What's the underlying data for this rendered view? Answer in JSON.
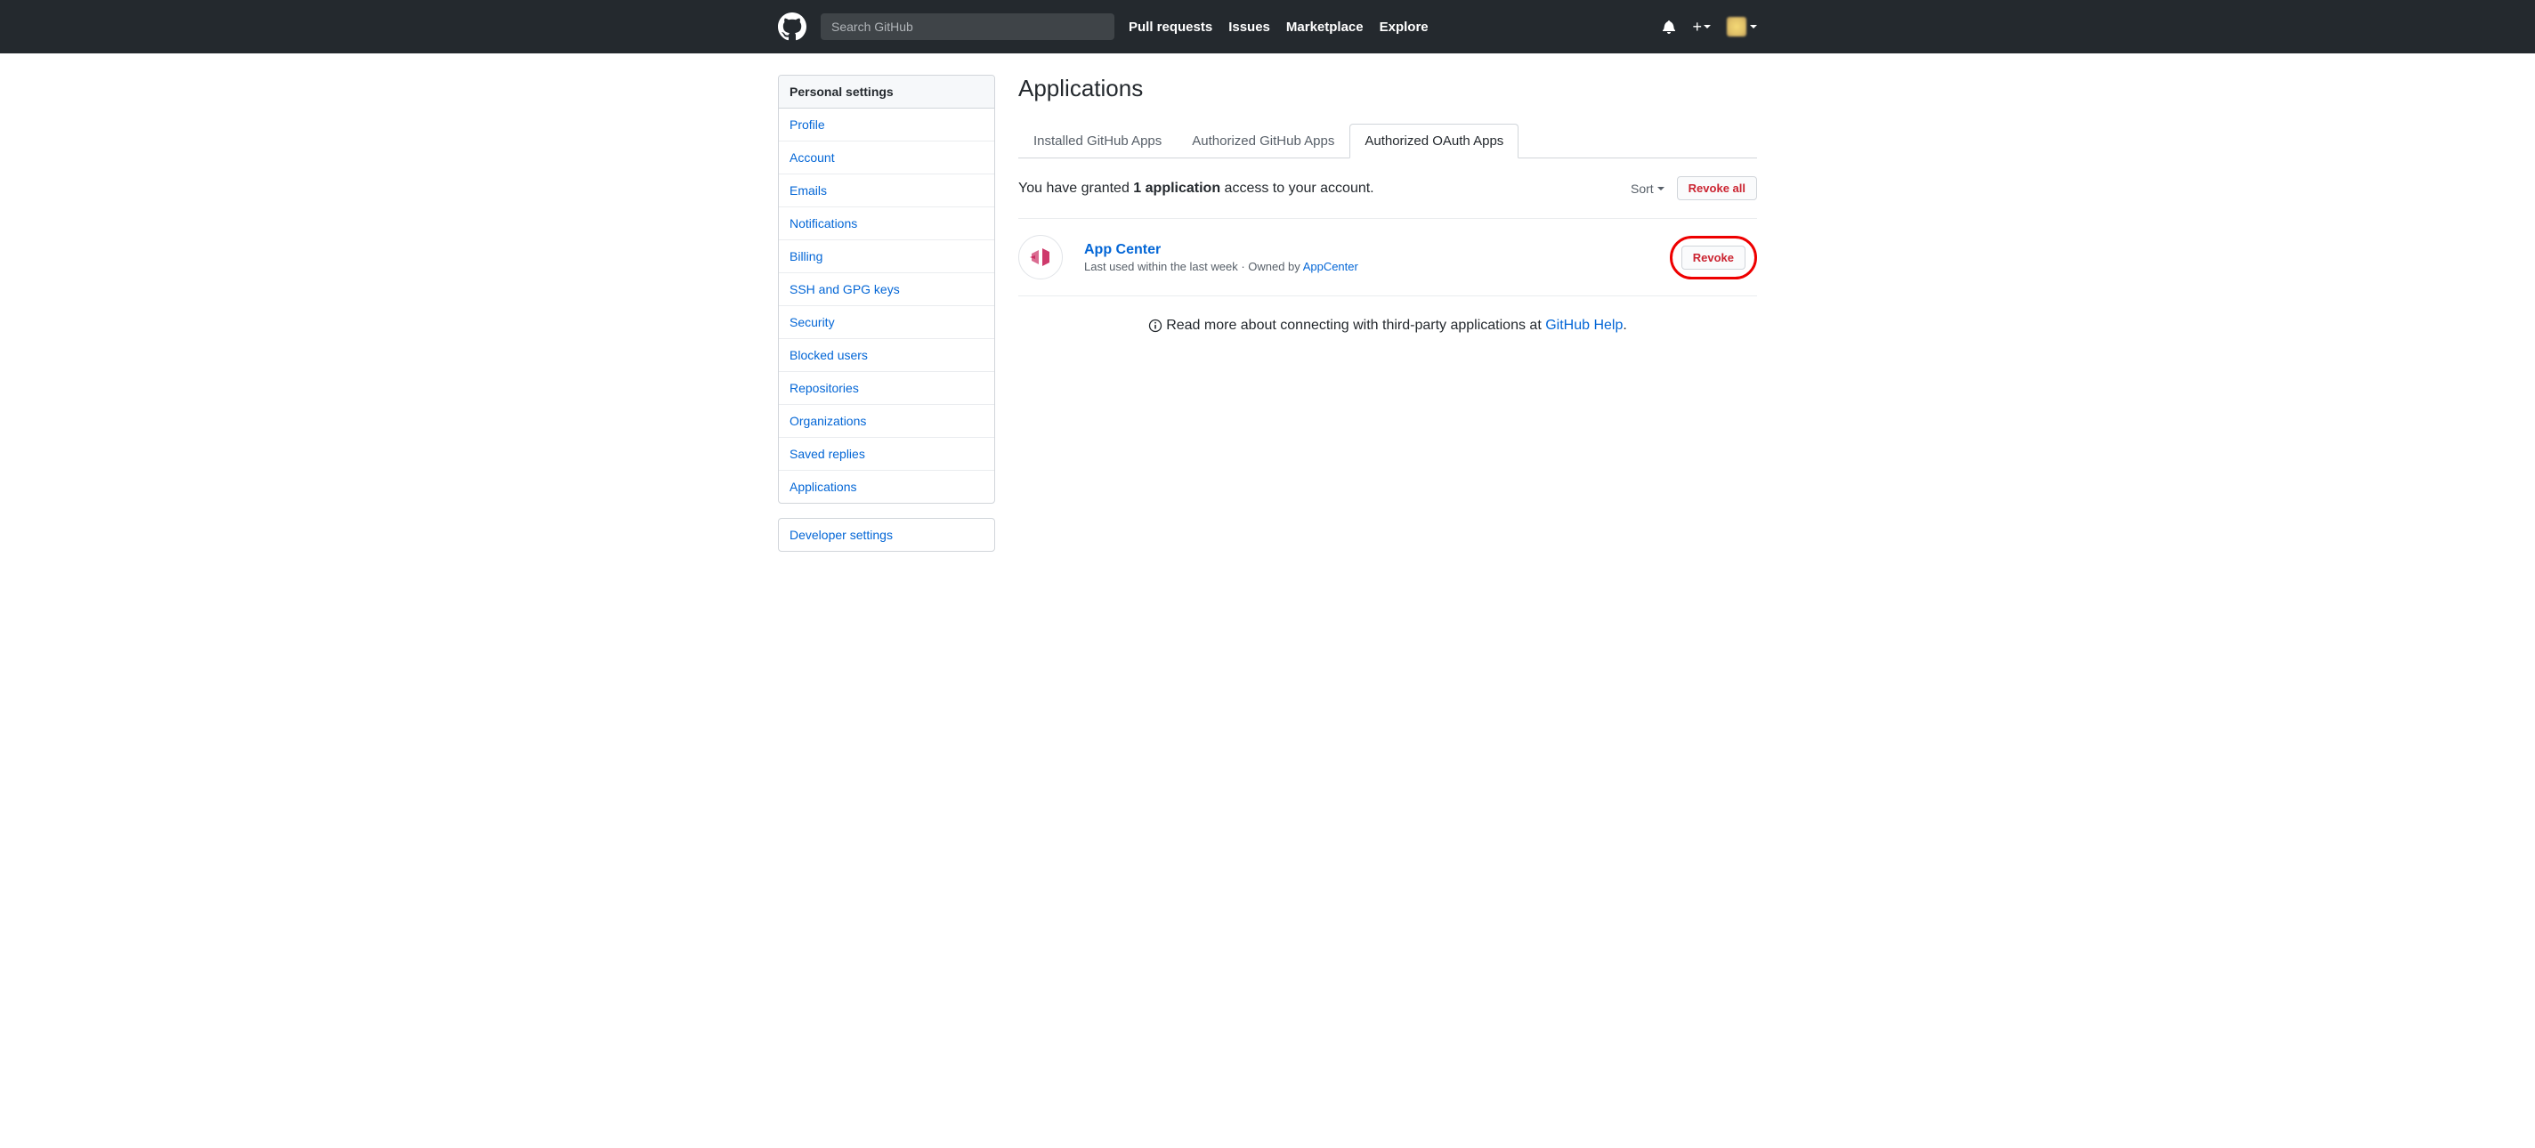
{
  "header": {
    "search_placeholder": "Search GitHub",
    "nav": [
      "Pull requests",
      "Issues",
      "Marketplace",
      "Explore"
    ]
  },
  "sidebar": {
    "heading": "Personal settings",
    "items": [
      "Profile",
      "Account",
      "Emails",
      "Notifications",
      "Billing",
      "SSH and GPG keys",
      "Security",
      "Blocked users",
      "Repositories",
      "Organizations",
      "Saved replies",
      "Applications"
    ],
    "dev_heading": "Developer settings"
  },
  "main": {
    "title": "Applications",
    "tabs": [
      {
        "label": "Installed GitHub Apps",
        "selected": false
      },
      {
        "label": "Authorized GitHub Apps",
        "selected": false
      },
      {
        "label": "Authorized OAuth Apps",
        "selected": true
      }
    ],
    "grant_prefix": "You have granted ",
    "grant_count": "1 application",
    "grant_suffix": " access to your account.",
    "sort_label": "Sort",
    "revoke_all_label": "Revoke all",
    "app": {
      "name": "App Center",
      "meta_prefix": "Last used within the last week · Owned by ",
      "owner": "AppCenter"
    },
    "revoke_label": "Revoke",
    "help_prefix": "Read more about connecting with third-party applications at ",
    "help_link": "GitHub Help",
    "help_suffix": "."
  }
}
